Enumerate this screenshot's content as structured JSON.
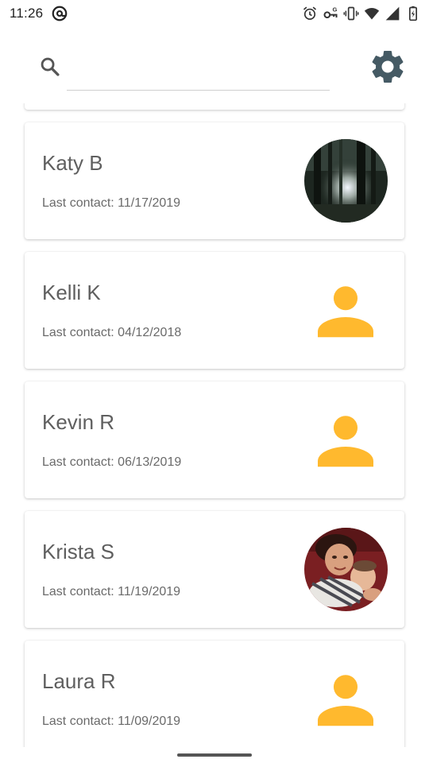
{
  "status_bar": {
    "time": "11:26",
    "icons": [
      "at-sign-icon",
      "alarm-icon",
      "vpn-key-icon",
      "vibrate-icon",
      "wifi-icon",
      "signal-icon",
      "battery-charging-icon"
    ]
  },
  "search": {
    "placeholder": "",
    "value": "",
    "settings_icon": "gear-icon",
    "accent_color": "#455A64"
  },
  "contacts": [
    {
      "name": "Katy B",
      "last_contact_label": "Last contact:",
      "last_contact_date": "11/17/2019",
      "avatar": "photo-forest"
    },
    {
      "name": "Kelli K",
      "last_contact_label": "Last contact:",
      "last_contact_date": "04/12/2018",
      "avatar": "default-person-icon"
    },
    {
      "name": "Kevin R",
      "last_contact_label": "Last contact:",
      "last_contact_date": "06/13/2019",
      "avatar": "default-person-icon"
    },
    {
      "name": "Krista S",
      "last_contact_label": "Last contact:",
      "last_contact_date": "11/19/2019",
      "avatar": "photo-mother-child"
    },
    {
      "name": "Laura R",
      "last_contact_label": "Last contact:",
      "last_contact_date": "11/09/2019",
      "avatar": "default-person-icon"
    }
  ],
  "colors": {
    "person_icon": "#FFB92E",
    "settings_icon": "#455A64"
  }
}
